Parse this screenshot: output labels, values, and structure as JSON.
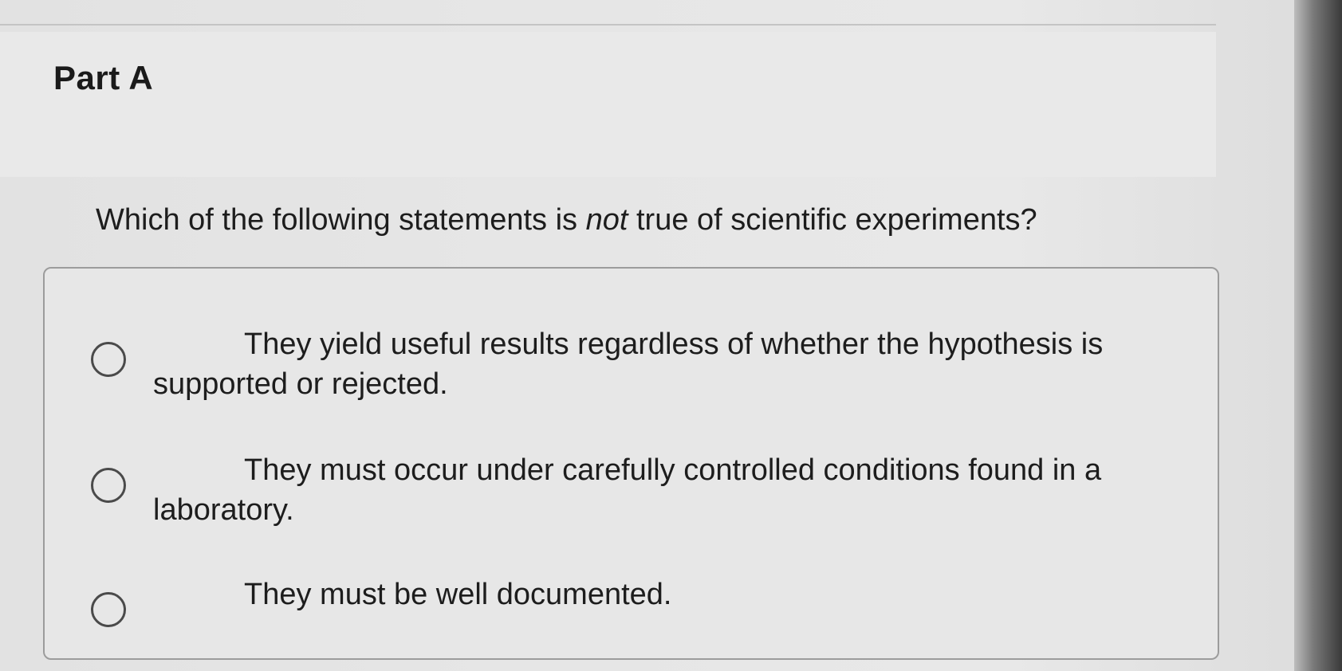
{
  "part": {
    "title": "Part A"
  },
  "question": {
    "prefix": "Which of the following statements is ",
    "emphasis": "not",
    "suffix": " true of scientific experiments?"
  },
  "options": [
    {
      "label": "They yield useful results regardless of whether the hypothesis is supported or rejected.",
      "selected": false
    },
    {
      "label": "They must occur under carefully controlled conditions found in a laboratory.",
      "selected": false
    },
    {
      "label": "They must be well documented.",
      "selected": false
    }
  ]
}
